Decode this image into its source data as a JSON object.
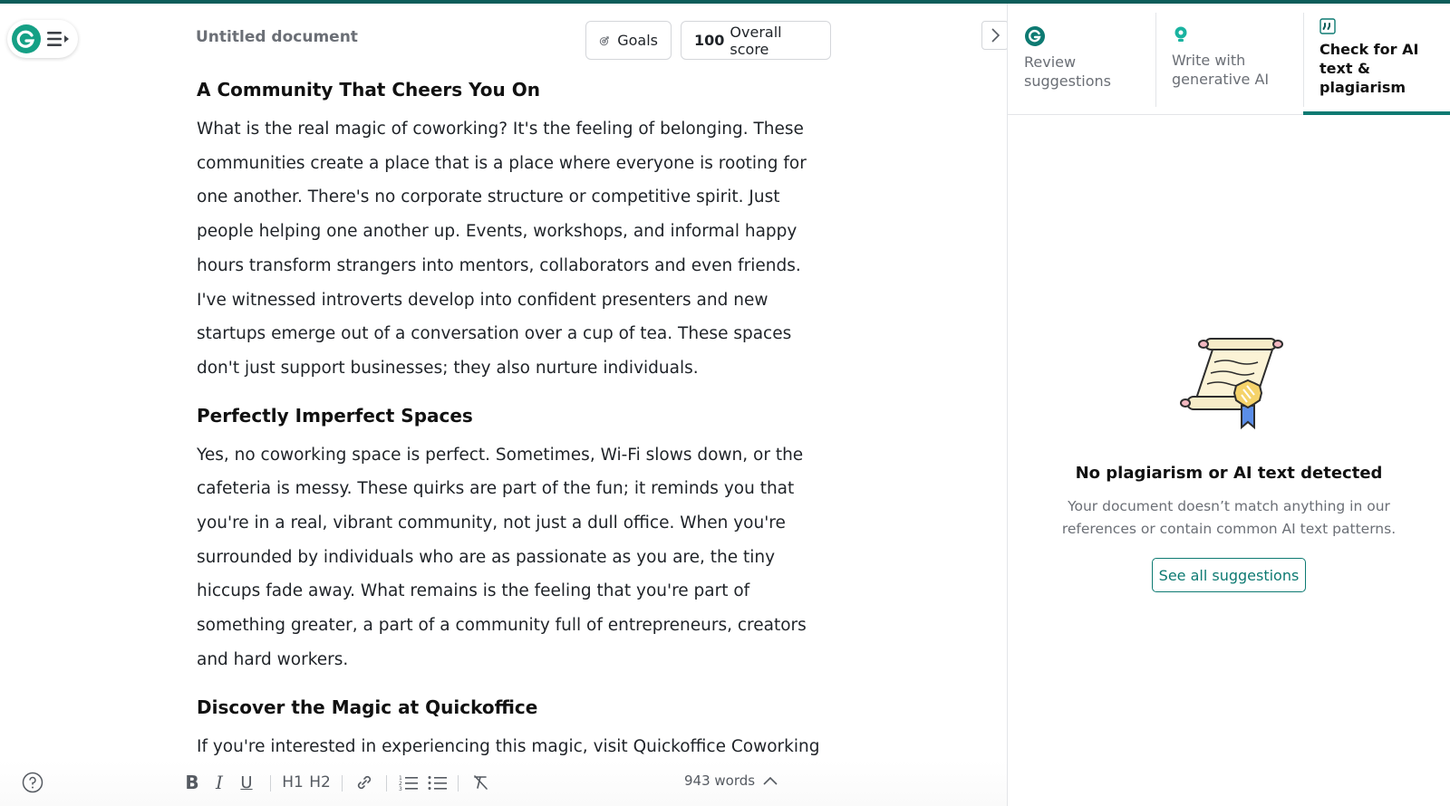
{
  "app": {
    "accent_color": "#0d7a72",
    "top_strip_color": "#0d5d5a"
  },
  "header": {
    "doc_title": "Untitled document",
    "goals_label": "Goals",
    "score_value": "100",
    "score_label": "Overall score"
  },
  "document": {
    "sections": [
      {
        "heading": "A Community That Cheers You On",
        "body": "What is the real magic of coworking? It's the feeling of belonging. These communities create a place that is a place where everyone is rooting for one another. There's no corporate structure or competitive spirit. Just people helping one another up. Events, workshops, and informal happy hours transform strangers into mentors, collaborators and even friends. I've witnessed introverts develop into confident presenters and new startups emerge out of a conversation over a cup of tea. These spaces don't just support businesses; they also nurture individuals."
      },
      {
        "heading": "Perfectly Imperfect Spaces",
        "body": "Yes, no coworking space is perfect. Sometimes, Wi-Fi slows down, or the cafeteria is messy. These quirks are part of the fun; it reminds you that you're in a real, vibrant community, not just a dull office. When you're surrounded by individuals who are as passionate as you are, the tiny hiccups fade away. What remains is the feeling that you're part of something greater, a part of a community full of entrepreneurs, creators and hard workers."
      },
      {
        "heading": "Discover the Magic at Quickoffice",
        "body": "If you're interested in experiencing this magic, visit Quickoffice Coworking"
      }
    ]
  },
  "toolbar": {
    "bold": "B",
    "italic": "I",
    "underline": "U",
    "h1": "H1",
    "h2": "H2",
    "word_count": "943 words"
  },
  "panel": {
    "tabs": [
      {
        "label": "Review suggestions",
        "icon": "grammarly-g-icon"
      },
      {
        "label": "Write with generative AI",
        "icon": "lightbulb-icon"
      },
      {
        "label": "Check for AI text & plagiarism",
        "icon": "quote-icon",
        "active": true
      }
    ],
    "empty_title": "No plagiarism or AI text detected",
    "empty_desc": "Your document doesn’t match anything in our references or contain common AI text patterns.",
    "see_all_label": "See all suggestions"
  }
}
